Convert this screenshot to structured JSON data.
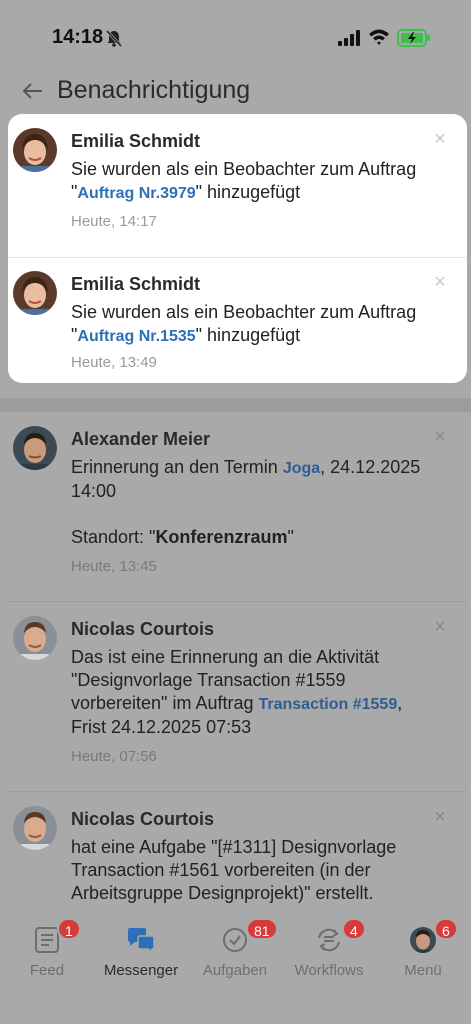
{
  "status_bar": {
    "time": "14:18"
  },
  "header": {
    "title": "Benachrichtigung"
  },
  "notifications": [
    {
      "name": "Emilia Schmidt",
      "text_before": "Sie wurden als ein Beobachter zum Auftrag \"",
      "link": "Auftrag Nr.3979",
      "text_after": "\" hinzugefügt",
      "time": "Heute, 14:17"
    },
    {
      "name": "Emilia Schmidt",
      "text_before": "Sie wurden als ein Beobachter zum Auftrag \"",
      "link": "Auftrag Nr.1535",
      "text_after": "\" hinzugefügt",
      "time": "Heute, 13:49"
    },
    {
      "name": "Alexander Meier",
      "text_before": "Erinnerung an den Termin ",
      "link": "Joga",
      "text_after": ", 24.12.2025 14:00",
      "location_label": "Standort: \"",
      "location_value": "Konferenzraum",
      "location_end": "\"",
      "time": "Heute, 13:45"
    },
    {
      "name": "Nicolas Courtois",
      "text_before": "Das ist eine Erinnerung an die Aktivität \"Designvorlage Transaction #1559 vorbereiten\" im Auftrag ",
      "link": "Transaction #1559",
      "text_after": ", Frist 24.12.2025 07:53",
      "time": "Heute, 07:56"
    },
    {
      "name": "Nicolas Courtois",
      "text_before": "hat eine Aufgabe \"[#1311] Designvorlage Transaction #1561 vorbereiten (in der Arbeitsgruppe Designprojekt)\" erstellt.",
      "time": ""
    }
  ],
  "close_glyph": "×",
  "tabs": [
    {
      "label": "Feed",
      "badge": "1",
      "icon": "feed-icon"
    },
    {
      "label": "Messenger",
      "badge": "",
      "icon": "messenger-icon"
    },
    {
      "label": "Aufgaben",
      "badge": "81",
      "icon": "tasks-icon"
    },
    {
      "label": "Workflows",
      "badge": "4",
      "icon": "workflows-icon"
    },
    {
      "label": "Menü",
      "badge": "6",
      "icon": "menu-avatar"
    }
  ],
  "colors": {
    "link": "#2f6fb8",
    "badge": "#d63a3a",
    "messenger_active": "#2f6fb8",
    "battery": "#3cc24a"
  }
}
